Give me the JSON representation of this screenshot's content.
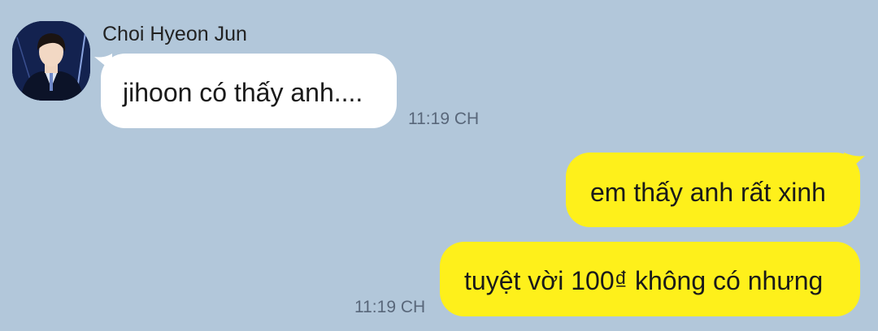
{
  "colors": {
    "chat_background": "#b2c7da",
    "incoming_bubble": "#ffffff",
    "outgoing_bubble": "#fef01b",
    "timestamp": "#59677a"
  },
  "sender": {
    "name": "Choi Hyeon Jun",
    "avatar_icon": "profile-photo"
  },
  "messages": [
    {
      "direction": "incoming",
      "text": "jihoon có thấy anh....",
      "time": "11:19 CH"
    },
    {
      "direction": "outgoing",
      "text": "em thấy anh rất xinh"
    },
    {
      "direction": "outgoing",
      "text": "tuyệt vời 100₫ không có nhưng",
      "time": "11:19 CH"
    }
  ]
}
